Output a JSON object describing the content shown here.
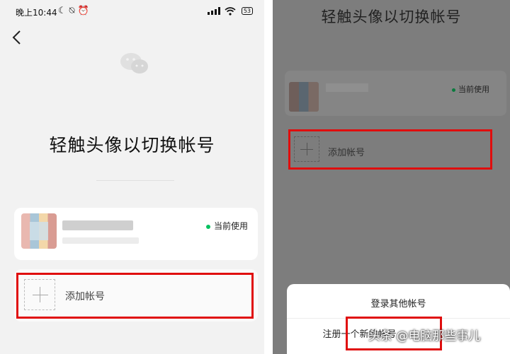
{
  "status_bar": {
    "time": "晚上10:44",
    "left_icons": [
      "moon-icon",
      "alarm-off-icon",
      "alarm-icon"
    ],
    "signal": "HD",
    "battery": "53"
  },
  "left_screen": {
    "title": "轻触头像以切换帐号",
    "current_account": {
      "badge": "当前使用"
    },
    "add_account": {
      "label": "添加帐号"
    }
  },
  "right_screen": {
    "title": "轻触头像以切换帐号",
    "current_account": {
      "badge": "当前使用"
    },
    "add_account": {
      "label": "添加帐号"
    },
    "action_sheet": {
      "login_other": "登录其他帐号",
      "register": "注册一个新的帐号"
    }
  },
  "watermark": "头条 @电脑那些事儿",
  "colors": {
    "highlight_red": "#e00d0d",
    "active_green": "#07c160"
  }
}
